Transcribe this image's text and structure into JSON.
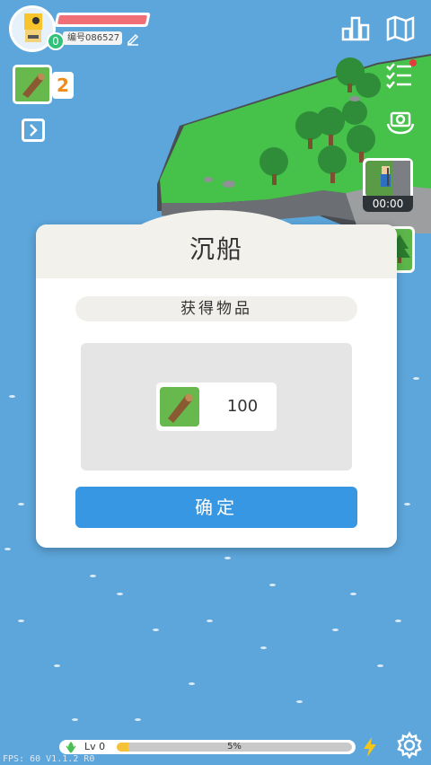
{
  "player": {
    "level": "0",
    "id_label": "编号086527",
    "hp_fraction": 1.0
  },
  "inventory": {
    "wood_count": "2"
  },
  "video_card": {
    "timer": "00:00"
  },
  "dialog": {
    "title": "沉船",
    "subtitle": "获得物品",
    "item_quantity": "100",
    "confirm_label": "确定"
  },
  "footer": {
    "level_label": "Lv 0",
    "xp_percent_label": "5%",
    "xp_fraction": 0.05,
    "debug_text": "FPS: 60   V1.1.2  R0"
  },
  "colors": {
    "sea": "#5da6db",
    "accent_button": "#3797e3",
    "hp": "#f06f77",
    "xp": "#f6c338",
    "wood_slot": "#67b84d"
  },
  "icons": [
    "edit-icon",
    "wood-log-icon",
    "expand-arrow-icon",
    "leaderboard-icon",
    "map-icon",
    "task-list-icon",
    "camera-rotate-icon",
    "lightning-icon",
    "gear-icon",
    "leaf-icon"
  ]
}
